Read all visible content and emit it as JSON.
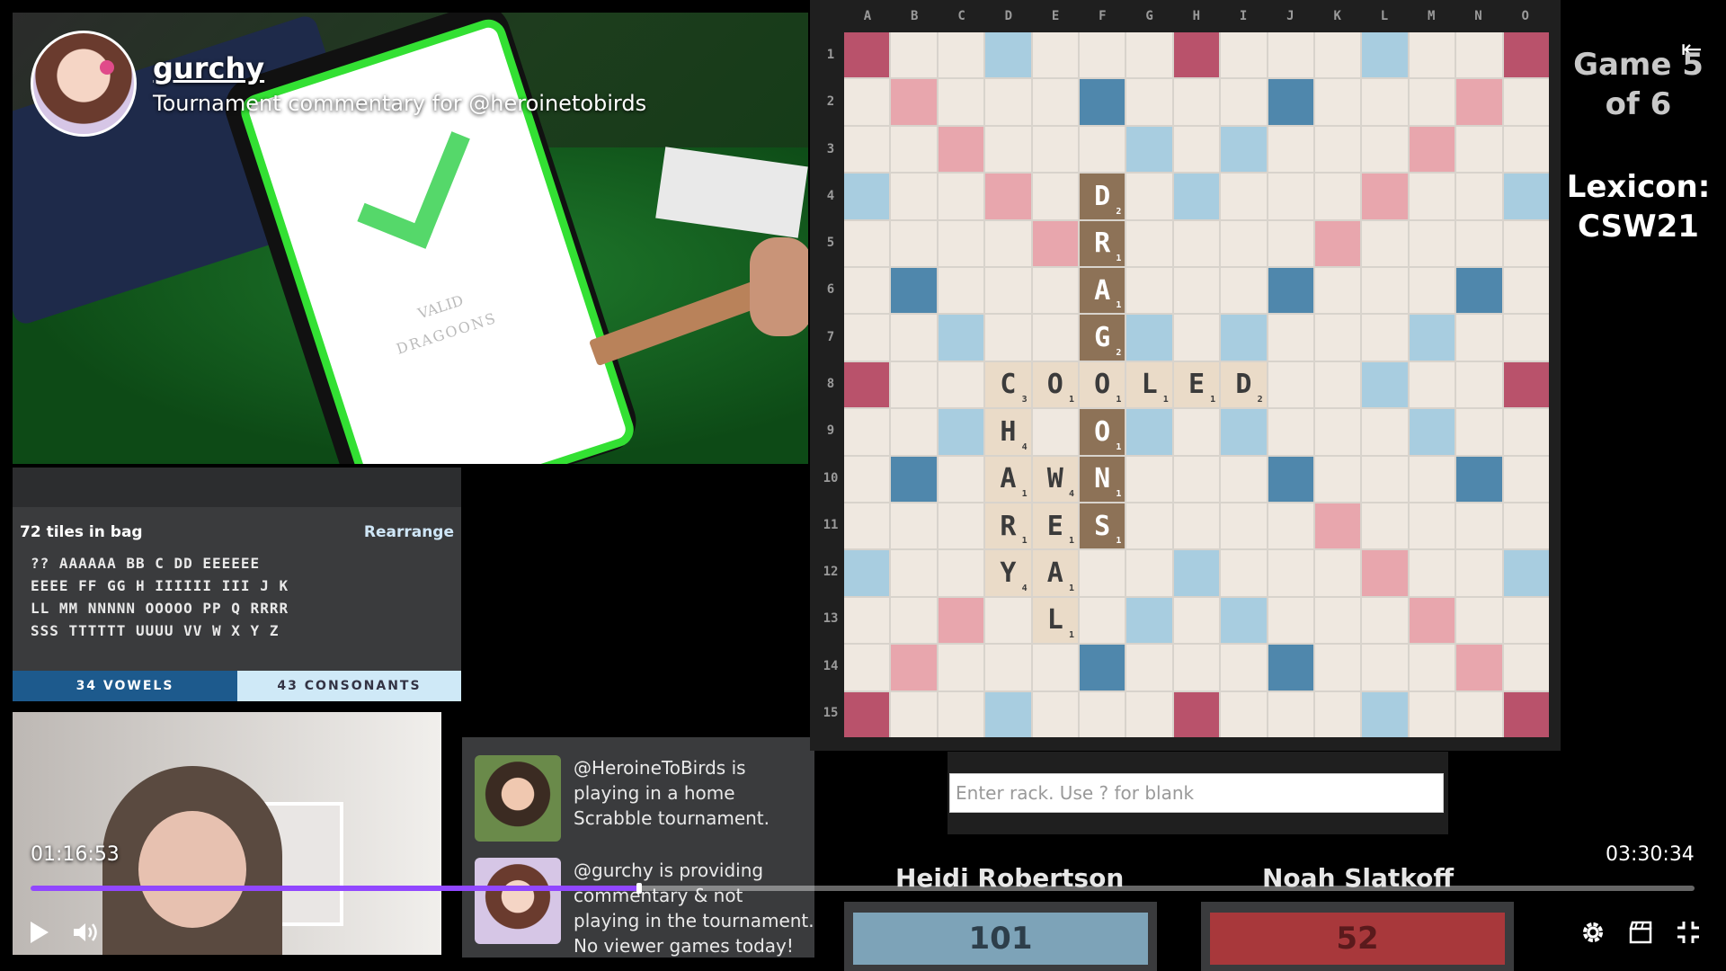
{
  "channel": {
    "name": "gurchy",
    "subtitle": "Tournament commentary for @heroinetobirds"
  },
  "camera": {
    "phone_word_status": "VALID",
    "phone_word": "DRAGOONS"
  },
  "tiles_panel": {
    "count_text": "72 tiles in bag",
    "rearrange_label": "Rearrange",
    "lines": [
      "?? AAAAAA BB C DD EEEEEE",
      "EEEE FF GG H IIIIII III J K",
      "LL MM NNNNN OOOOO PP Q RRRR",
      "SSS TTTTTT UUUU VV W X Y Z"
    ],
    "vowels_label": "34 VOWELS",
    "consonants_label": "43 CONSONANTS"
  },
  "commentary": [
    {
      "text": "@HeroineToBirds is playing in a home Scrabble tournament."
    },
    {
      "text": "@gurchy is providing commentary & not playing in the tournament. No viewer games today!"
    }
  ],
  "board": {
    "columns": [
      "A",
      "B",
      "C",
      "D",
      "E",
      "F",
      "G",
      "H",
      "I",
      "J",
      "K",
      "L",
      "M",
      "N",
      "O"
    ],
    "rows": [
      "1",
      "2",
      "3",
      "4",
      "5",
      "6",
      "7",
      "8",
      "9",
      "10",
      "11",
      "12",
      "13",
      "14",
      "15"
    ],
    "tiles": [
      {
        "row": 4,
        "col": 6,
        "letter": "D",
        "points": "2",
        "new": true
      },
      {
        "row": 5,
        "col": 6,
        "letter": "R",
        "points": "1",
        "new": true
      },
      {
        "row": 6,
        "col": 6,
        "letter": "A",
        "points": "1",
        "new": true
      },
      {
        "row": 7,
        "col": 6,
        "letter": "G",
        "points": "2",
        "new": true
      },
      {
        "row": 8,
        "col": 4,
        "letter": "C",
        "points": "3",
        "new": false
      },
      {
        "row": 8,
        "col": 5,
        "letter": "O",
        "points": "1",
        "new": false
      },
      {
        "row": 8,
        "col": 6,
        "letter": "O",
        "points": "1",
        "new": false
      },
      {
        "row": 8,
        "col": 7,
        "letter": "L",
        "points": "1",
        "new": false
      },
      {
        "row": 8,
        "col": 8,
        "letter": "E",
        "points": "1",
        "new": false
      },
      {
        "row": 8,
        "col": 9,
        "letter": "D",
        "points": "2",
        "new": false
      },
      {
        "row": 9,
        "col": 4,
        "letter": "H",
        "points": "4",
        "new": false
      },
      {
        "row": 9,
        "col": 6,
        "letter": "O",
        "points": "1",
        "new": true
      },
      {
        "row": 10,
        "col": 4,
        "letter": "A",
        "points": "1",
        "new": false
      },
      {
        "row": 10,
        "col": 5,
        "letter": "W",
        "points": "4",
        "new": false
      },
      {
        "row": 10,
        "col": 6,
        "letter": "N",
        "points": "1",
        "new": true
      },
      {
        "row": 11,
        "col": 4,
        "letter": "R",
        "points": "1",
        "new": false
      },
      {
        "row": 11,
        "col": 5,
        "letter": "E",
        "points": "1",
        "new": false
      },
      {
        "row": 11,
        "col": 6,
        "letter": "S",
        "points": "1",
        "new": true
      },
      {
        "row": 12,
        "col": 4,
        "letter": "Y",
        "points": "4",
        "new": false
      },
      {
        "row": 12,
        "col": 5,
        "letter": "A",
        "points": "1",
        "new": false
      },
      {
        "row": 13,
        "col": 5,
        "letter": "L",
        "points": "1",
        "new": false
      }
    ]
  },
  "game": {
    "game_number_text": "Game 5 of 6",
    "lexicon_label": "Lexicon:",
    "lexicon_value": "CSW21"
  },
  "rack": {
    "placeholder": "Enter rack. Use ? for blank",
    "value": ""
  },
  "players": [
    {
      "name": "Heidi Robertson",
      "score": "101",
      "color": "#7da3b8"
    },
    {
      "name": "Noah Slatkoff",
      "score": "52",
      "color": "#a8383b"
    }
  ],
  "video": {
    "current_time": "01:16:53",
    "duration": "03:30:34",
    "progress_fraction": 0.3655
  },
  "icons": {
    "play": "play-icon",
    "volume": "volume-icon",
    "settings": "gear-icon",
    "clip": "clapperboard-icon",
    "exit_fullscreen": "exit-fullscreen-icon",
    "back": "arrow-left-bar-icon"
  }
}
